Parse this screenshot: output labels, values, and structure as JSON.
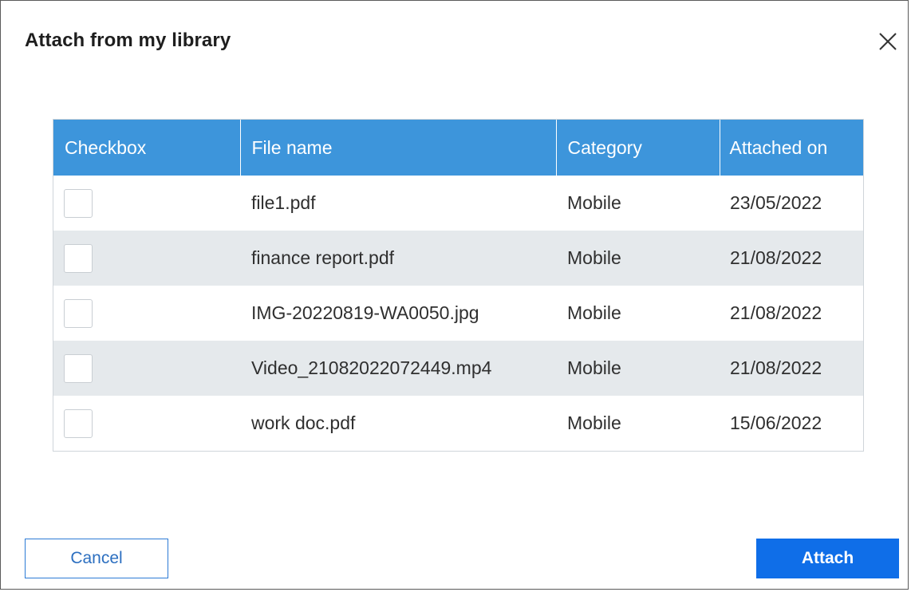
{
  "dialog": {
    "title": "Attach from my library",
    "close_icon": "close-icon"
  },
  "table": {
    "columns": [
      "Checkbox",
      "File name",
      "Category",
      "Attached on"
    ],
    "rows": [
      {
        "checked": false,
        "file_name": "file1.pdf",
        "category": "Mobile",
        "attached_on": "23/05/2022"
      },
      {
        "checked": false,
        "file_name": "finance report.pdf",
        "category": "Mobile",
        "attached_on": "21/08/2022"
      },
      {
        "checked": false,
        "file_name": "IMG-20220819-WA0050.jpg",
        "category": "Mobile",
        "attached_on": "21/08/2022"
      },
      {
        "checked": false,
        "file_name": "Video_21082022072449.mp4",
        "category": "Mobile",
        "attached_on": "21/08/2022"
      },
      {
        "checked": false,
        "file_name": "work doc.pdf",
        "category": "Mobile",
        "attached_on": "15/06/2022"
      }
    ]
  },
  "footer": {
    "cancel_label": "Cancel",
    "attach_label": "Attach"
  },
  "colors": {
    "header_bg": "#3d95db",
    "stripe_bg": "#e5e9ec",
    "primary_button": "#0f6ee8",
    "cancel_border": "#2c7bd6"
  }
}
